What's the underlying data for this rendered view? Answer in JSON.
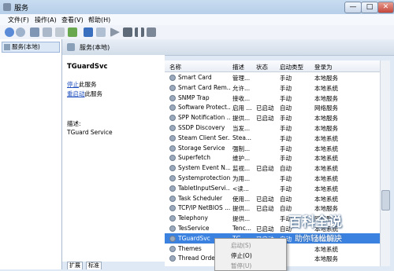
{
  "window": {
    "title": "服务",
    "min": "—",
    "max": "□",
    "close": "✕"
  },
  "menu": [
    "文件(F)",
    "操作(A)",
    "查看(V)",
    "帮助(H)"
  ],
  "left_tree": {
    "item": "服务(本地)"
  },
  "header": {
    "label": "服务(本地)"
  },
  "desc": {
    "service_name": "TGuardSvc",
    "stop_link": "停止",
    "stop_suffix": "此服务",
    "restart_link": "重启动",
    "restart_suffix": "此服务",
    "desc_label": "描述:",
    "desc_text": "TGuard Service"
  },
  "columns": [
    "名称",
    "描述",
    "状态",
    "启动类型",
    "登录为"
  ],
  "rows": [
    {
      "name": "Smart Card",
      "desc": "管理...",
      "status": "",
      "startup": "手动",
      "logon": "本地服务"
    },
    {
      "name": "Smart Card Rem...",
      "desc": "允许...",
      "status": "",
      "startup": "手动",
      "logon": "本地系统"
    },
    {
      "name": "SNMP Trap",
      "desc": "接收...",
      "status": "",
      "startup": "手动",
      "logon": "本地服务"
    },
    {
      "name": "Software Protect...",
      "desc": "启用 ...",
      "status": "已启动",
      "startup": "自动",
      "logon": "网络服务"
    },
    {
      "name": "SPP Notification ...",
      "desc": "提供...",
      "status": "已启动",
      "startup": "手动",
      "logon": "本地服务"
    },
    {
      "name": "SSDP Discovery",
      "desc": "当发...",
      "status": "",
      "startup": "手动",
      "logon": "本地服务"
    },
    {
      "name": "Steam Client Ser...",
      "desc": "Stea...",
      "status": "",
      "startup": "手动",
      "logon": "本地系统"
    },
    {
      "name": "Storage Service",
      "desc": "强制...",
      "status": "",
      "startup": "手动",
      "logon": "本地系统"
    },
    {
      "name": "Superfetch",
      "desc": "维护...",
      "status": "",
      "startup": "手动",
      "logon": "本地系统"
    },
    {
      "name": "System Event N...",
      "desc": "监视...",
      "status": "已启动",
      "startup": "自动",
      "logon": "本地系统"
    },
    {
      "name": "Systemprotection",
      "desc": "为用...",
      "status": "",
      "startup": "手动",
      "logon": "本地系统"
    },
    {
      "name": "TabletInputServi...",
      "desc": "<读...",
      "status": "",
      "startup": "手动",
      "logon": "本地系统"
    },
    {
      "name": "Task Scheduler",
      "desc": "使用...",
      "status": "已启动",
      "startup": "自动",
      "logon": "本地系统"
    },
    {
      "name": "TCP/IP NetBIOS ...",
      "desc": "提供...",
      "status": "已启动",
      "startup": "自动",
      "logon": "本地服务"
    },
    {
      "name": "Telephony",
      "desc": "提供...",
      "status": "",
      "startup": "手动",
      "logon": "网络服务"
    },
    {
      "name": "TesService",
      "desc": "Tenc...",
      "status": "已启动",
      "startup": "自动",
      "logon": "本地系统"
    },
    {
      "name": "TGuardSvc",
      "desc": "TG...",
      "status": "已启动",
      "startup": "自动",
      "logon": "本地系统"
    },
    {
      "name": "Themes",
      "desc": "",
      "status": "",
      "startup": "",
      "logon": "本地系统"
    },
    {
      "name": "Thread Order",
      "desc": "",
      "status": "",
      "startup": "",
      "logon": "本地服务"
    }
  ],
  "selected_index": 16,
  "context_menu": [
    {
      "label": "启动(S)",
      "disabled": true
    },
    {
      "label": "停止(O)",
      "disabled": false
    },
    {
      "label": "暂停(U)",
      "disabled": true
    }
  ],
  "tabs": [
    "扩展",
    "标准"
  ],
  "watermark": {
    "big": "百科全说",
    "small": "助你轻松解决"
  }
}
